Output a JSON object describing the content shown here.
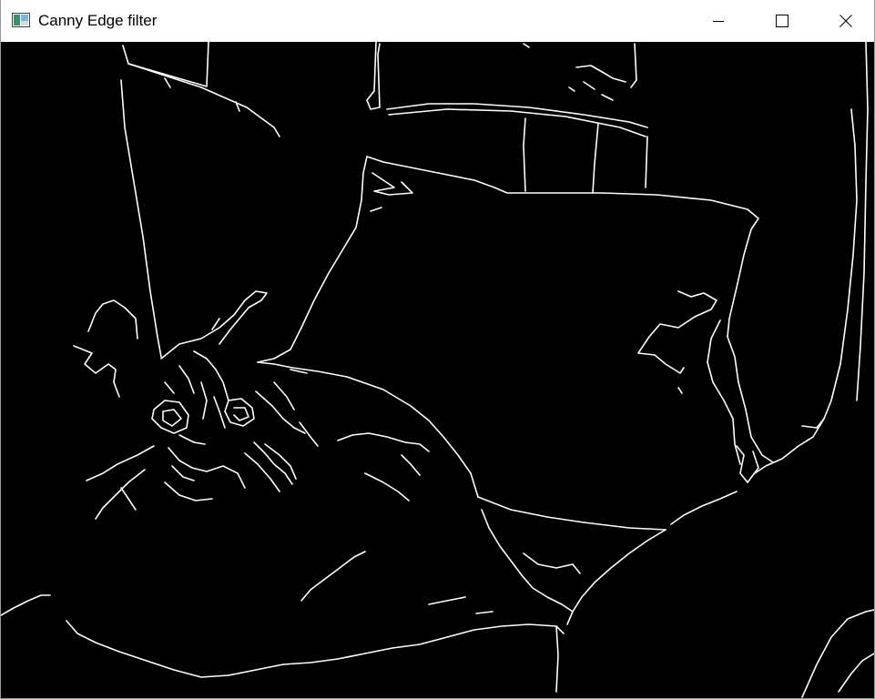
{
  "window": {
    "title": "Canny Edge filter",
    "icon": "app-window-icon",
    "controls": {
      "minimize_icon": "minimize-icon",
      "maximize_icon": "maximize-icon",
      "close_icon": "close-icon"
    }
  },
  "canvas": {
    "background": "#000000",
    "edge_color": "#ffffff"
  }
}
